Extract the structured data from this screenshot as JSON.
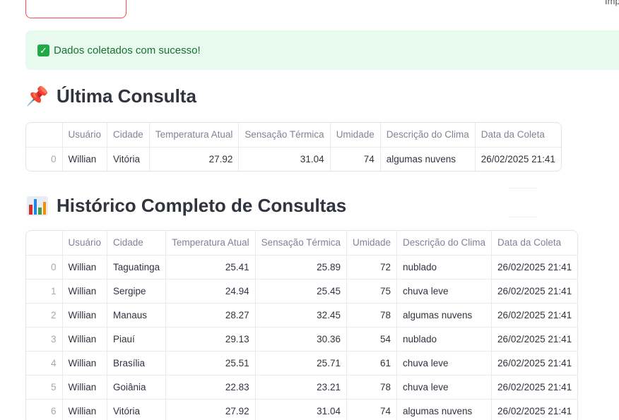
{
  "alert": {
    "message": "Dados coletados com sucesso!",
    "icon": "check-icon",
    "color": "#177233",
    "background": "#e8f9ee"
  },
  "top_right_text": "Imp",
  "last_query": {
    "heading": "Última Consulta",
    "icon": "pushpin-icon",
    "columns": [
      "",
      "Usuário",
      "Cidade",
      "Temperatura Atual",
      "Sensação Térmica",
      "Umidade",
      "Descrição do Clima",
      "Data da Coleta"
    ],
    "rows": [
      [
        "0",
        "Willian",
        "Vitória",
        "27.92",
        "31.04",
        "74",
        "algumas nuvens",
        "26/02/2025 21:41"
      ]
    ]
  },
  "history": {
    "heading": "Histórico Completo de Consultas",
    "icon": "bar-chart-icon",
    "columns": [
      "",
      "Usuário",
      "Cidade",
      "Temperatura Atual",
      "Sensação Térmica",
      "Umidade",
      "Descrição do Clima",
      "Data da Coleta"
    ],
    "rows": [
      [
        "0",
        "Willian",
        "Taguatinga",
        "25.41",
        "25.89",
        "72",
        "nublado",
        "26/02/2025 21:41"
      ],
      [
        "1",
        "Willian",
        "Sergipe",
        "24.94",
        "25.45",
        "75",
        "chuva leve",
        "26/02/2025 21:41"
      ],
      [
        "2",
        "Willian",
        "Manaus",
        "28.27",
        "32.45",
        "78",
        "algumas nuvens",
        "26/02/2025 21:41"
      ],
      [
        "3",
        "Willian",
        "Piauí",
        "29.13",
        "30.36",
        "54",
        "nublado",
        "26/02/2025 21:41"
      ],
      [
        "4",
        "Willian",
        "Brasília",
        "25.51",
        "25.71",
        "61",
        "chuva leve",
        "26/02/2025 21:41"
      ],
      [
        "5",
        "Willian",
        "Goiânia",
        "22.83",
        "23.21",
        "78",
        "chuva leve",
        "26/02/2025 21:41"
      ],
      [
        "6",
        "Willian",
        "Vitória",
        "27.92",
        "31.04",
        "74",
        "algumas nuvens",
        "26/02/2025 21:41"
      ]
    ]
  }
}
